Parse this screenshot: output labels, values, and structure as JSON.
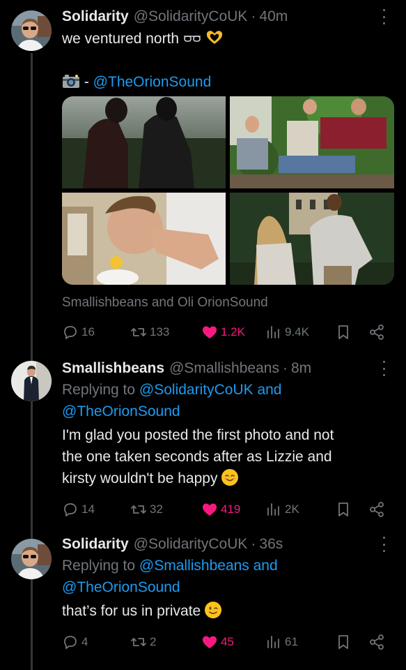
{
  "tweets": [
    {
      "name": "Solidarity",
      "handle": "@SolidarityCoUK",
      "time": "40m",
      "text": "we ventured north",
      "credit_prefix": "- ",
      "credit_handle": "@TheOrionSound",
      "tagged": "Smallishbeans and Oli OrionSound",
      "stats": {
        "replies": "16",
        "retweets": "133",
        "likes": "1.2K",
        "views": "9.4K"
      }
    },
    {
      "name": "Smallishbeans",
      "handle": "@Smallishbeans",
      "time": "8m",
      "reply_prefix": "Replying to ",
      "reply_to_1": "@SolidarityCoUK and",
      "reply_to_2": "@TheOrionSound",
      "text_line1": "I'm glad you posted the first photo and not",
      "text_line2": "the one taken seconds after as Lizzie and",
      "text_line3": "kirsty wouldn't be happy",
      "stats": {
        "replies": "14",
        "retweets": "32",
        "likes": "419",
        "views": "2K"
      }
    },
    {
      "name": "Solidarity",
      "handle": "@SolidarityCoUK",
      "time": "36s",
      "reply_prefix": "Replying to ",
      "reply_to_1": "@Smallishbeans and",
      "reply_to_2": "@TheOrionSound",
      "text": "that’s for us in private",
      "stats": {
        "replies": "4",
        "retweets": "2",
        "likes": "45",
        "views": "61"
      }
    }
  ],
  "colors": {
    "background": "#000000",
    "text": "#e7e9ea",
    "muted": "#71767b",
    "link": "#1d9bf0",
    "like": "#f91880"
  },
  "icons": [
    "reply-icon",
    "retweet-icon",
    "like-icon",
    "views-icon",
    "bookmark-icon",
    "share-icon",
    "more-icon",
    "sunglasses-emoji",
    "heart-hands-emoji",
    "camera-emoji",
    "smiling-emoji",
    "winking-emoji"
  ]
}
